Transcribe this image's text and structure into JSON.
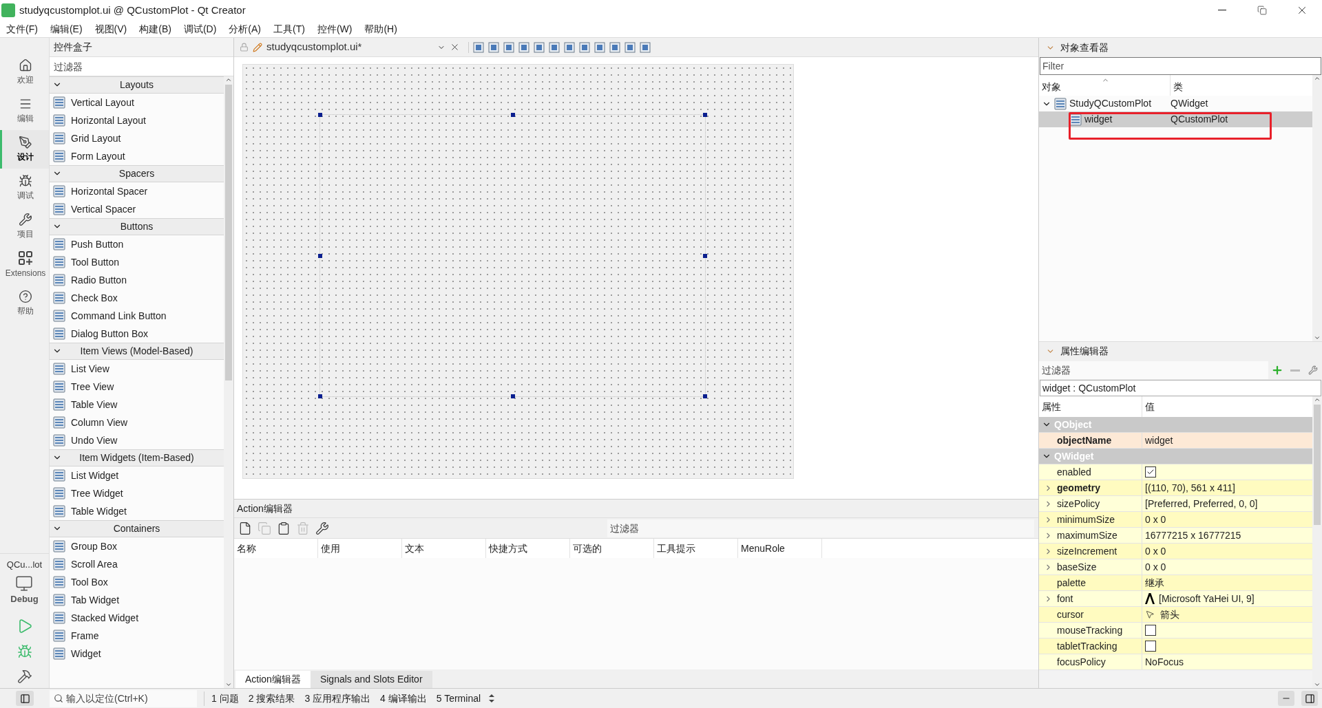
{
  "window": {
    "title": "studyqcustomplot.ui @ QCustomPlot - Qt Creator"
  },
  "menu": [
    "文件(F)",
    "编辑(E)",
    "视图(V)",
    "构建(B)",
    "调试(D)",
    "分析(A)",
    "工具(T)",
    "控件(W)",
    "帮助(H)"
  ],
  "mode_bar": [
    {
      "label": "欢迎",
      "selected": false
    },
    {
      "label": "编辑",
      "selected": false
    },
    {
      "label": "设计",
      "selected": true
    },
    {
      "label": "调试",
      "selected": false
    },
    {
      "label": "项目",
      "selected": false
    },
    {
      "label": "Extensions",
      "selected": false
    },
    {
      "label": "帮助",
      "selected": false
    }
  ],
  "kit": {
    "project": "QCu...lot",
    "build": "Debug"
  },
  "widget_box": {
    "title": "控件盒子",
    "filter_placeholder": "过滤器",
    "categories": [
      {
        "name": "Layouts",
        "expanded": true,
        "items": [
          "Vertical Layout",
          "Horizontal Layout",
          "Grid Layout",
          "Form Layout"
        ]
      },
      {
        "name": "Spacers",
        "expanded": true,
        "items": [
          "Horizontal Spacer",
          "Vertical Spacer"
        ]
      },
      {
        "name": "Buttons",
        "expanded": true,
        "items": [
          "Push Button",
          "Tool Button",
          "Radio Button",
          "Check Box",
          "Command Link Button",
          "Dialog Button Box"
        ]
      },
      {
        "name": "Item Views (Model-Based)",
        "expanded": true,
        "items": [
          "List View",
          "Tree View",
          "Table View",
          "Column View",
          "Undo View"
        ]
      },
      {
        "name": "Item Widgets (Item-Based)",
        "expanded": true,
        "items": [
          "List Widget",
          "Tree Widget",
          "Table Widget"
        ]
      },
      {
        "name": "Containers",
        "expanded": true,
        "items": [
          "Group Box",
          "Scroll Area",
          "Tool Box",
          "Tab Widget",
          "Stacked Widget",
          "Frame",
          "Widget"
        ]
      }
    ]
  },
  "editor": {
    "file_tab": "studyqcustomplot.ui*"
  },
  "action_editor": {
    "title": "Action编辑器",
    "filter_placeholder": "过滤器",
    "toolbar": [
      {
        "disabled": false
      },
      {
        "disabled": true
      },
      {
        "disabled": false
      },
      {
        "disabled": true
      },
      {
        "disabled": false
      }
    ],
    "columns": [
      "名称",
      "使用",
      "文本",
      "快捷方式",
      "可选的",
      "工具提示",
      "MenuRole"
    ]
  },
  "bottom_tabs": [
    {
      "label": "Action编辑器",
      "selected": true
    },
    {
      "label": "Signals and Slots Editor",
      "selected": false
    }
  ],
  "object_inspector": {
    "title": "对象查看器",
    "filter_placeholder": "Filter",
    "columns": [
      "对象",
      "类"
    ],
    "tree": [
      {
        "name": "StudyQCustomPlot",
        "class": "QWidget",
        "expanded": true,
        "selected": false,
        "children": [
          {
            "name": "widget",
            "class": "QCustomPlot",
            "selected": true
          }
        ]
      }
    ]
  },
  "property_editor": {
    "title": "属性编辑器",
    "filter_placeholder": "过滤器",
    "object_label": "widget : QCustomPlot",
    "columns": [
      "属性",
      "值"
    ],
    "groups": [
      {
        "name": "QObject",
        "expanded": true,
        "properties": [
          {
            "name": "objectName",
            "kind": "text",
            "value": "widget",
            "modified": true,
            "expandable": false
          }
        ]
      },
      {
        "name": "QWidget",
        "expanded": true,
        "properties": [
          {
            "name": "enabled",
            "kind": "checkbox",
            "checked": true,
            "modified": false,
            "expandable": false
          },
          {
            "name": "geometry",
            "kind": "text",
            "value": "[(110, 70), 561 x 411]",
            "modified": true,
            "expandable": true
          },
          {
            "name": "sizePolicy",
            "kind": "text",
            "value": "[Preferred, Preferred, 0, 0]",
            "modified": false,
            "expandable": true
          },
          {
            "name": "minimumSize",
            "kind": "text",
            "value": "0 x 0",
            "modified": false,
            "expandable": true
          },
          {
            "name": "maximumSize",
            "kind": "text",
            "value": "16777215 x 16777215",
            "modified": false,
            "expandable": true
          },
          {
            "name": "sizeIncrement",
            "kind": "text",
            "value": "0 x 0",
            "modified": false,
            "expandable": true
          },
          {
            "name": "baseSize",
            "kind": "text",
            "value": "0 x 0",
            "modified": false,
            "expandable": true
          },
          {
            "name": "palette",
            "kind": "text",
            "value": "继承",
            "modified": false,
            "expandable": false
          },
          {
            "name": "font",
            "kind": "font",
            "value": "[Microsoft YaHei UI, 9]",
            "modified": false,
            "expandable": true
          },
          {
            "name": "cursor",
            "kind": "cursor",
            "value": "箭头",
            "modified": false,
            "expandable": false
          },
          {
            "name": "mouseTracking",
            "kind": "checkbox",
            "checked": false,
            "modified": false,
            "expandable": false
          },
          {
            "name": "tabletTracking",
            "kind": "checkbox",
            "checked": false,
            "modified": false,
            "expandable": false
          },
          {
            "name": "focusPolicy",
            "kind": "text",
            "value": "NoFocus",
            "modified": false,
            "expandable": false
          }
        ]
      }
    ]
  },
  "status_bar": {
    "locator_placeholder": "输入以定位(Ctrl+K)",
    "panes": [
      "1 问题",
      "2 搜索结果",
      "3 应用程序输出",
      "4 编译输出",
      "5 Terminal"
    ]
  }
}
